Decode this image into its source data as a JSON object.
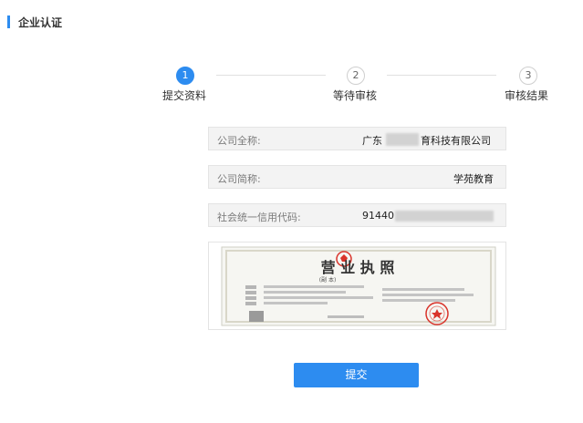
{
  "header": {
    "title": "企业认证"
  },
  "steps": [
    {
      "number": "1",
      "label": "提交资料",
      "state": "active"
    },
    {
      "number": "2",
      "label": "等待审核",
      "state": "pending"
    },
    {
      "number": "3",
      "label": "审核结果",
      "state": "pending"
    }
  ],
  "form": {
    "company_full_name": {
      "label": "公司全称:",
      "value_prefix": "广东",
      "value_suffix": "育科技有限公司"
    },
    "company_short_name": {
      "label": "公司简称:",
      "value": "学苑教育"
    },
    "credit_code": {
      "label": "社会统一信用代码:",
      "value_prefix": "91440"
    }
  },
  "license": {
    "title": "营 业 执 照",
    "subtitle": "(副  本)"
  },
  "actions": {
    "submit_label": "提交"
  },
  "colors": {
    "accent": "#2d8cf0",
    "field_bg": "#f3f3f3",
    "license_red": "#d9342b"
  }
}
